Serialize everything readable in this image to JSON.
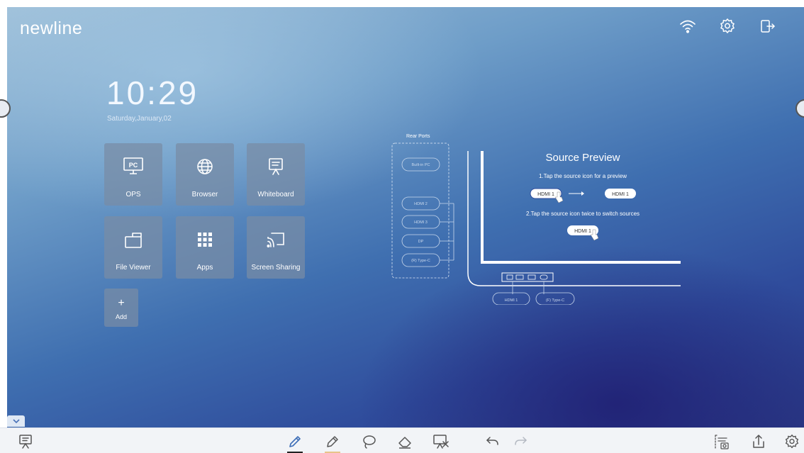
{
  "brand": {
    "logo": "newline"
  },
  "status_icons": [
    "wifi-icon",
    "settings-icon",
    "exit-icon"
  ],
  "clock": {
    "time": "10:29",
    "date": "Saturday,January,02"
  },
  "tiles": [
    {
      "label": "OPS",
      "icon": "pc-icon"
    },
    {
      "label": "Browser",
      "icon": "globe-icon"
    },
    {
      "label": "Whiteboard",
      "icon": "whiteboard-icon"
    },
    {
      "label": "File Viewer",
      "icon": "folder-icon"
    },
    {
      "label": "Apps",
      "icon": "grid-icon"
    },
    {
      "label": "Screen Sharing",
      "icon": "cast-icon"
    }
  ],
  "add_tile": {
    "symbol": "+",
    "label": "Add"
  },
  "source_panel": {
    "rear_ports_title": "Rear Ports",
    "rear_ports": [
      "Built-in PC",
      "HDMI 2",
      "HDMI 3",
      "DP",
      "(R) Type-C"
    ],
    "front_ports": [
      "HDMI 1",
      "(F) Type-C"
    ],
    "title": "Source Preview",
    "step1": "1.Tap the source icon for a preview",
    "step2": "2.Tap the source icon twice to switch sources",
    "pill_label": "HDMI 1"
  },
  "bottom_toolbar": {
    "left": [
      "whiteboard-icon"
    ],
    "center": [
      "pen-icon",
      "highlighter-icon",
      "lasso-icon",
      "eraser-icon",
      "clear-board-icon",
      "undo-icon",
      "redo-icon"
    ],
    "right": [
      "screenshot-icon",
      "share-icon",
      "settings-icon"
    ],
    "colors": {
      "pen_underline": "#222222",
      "highlighter_underline": "#e8c48a"
    }
  }
}
